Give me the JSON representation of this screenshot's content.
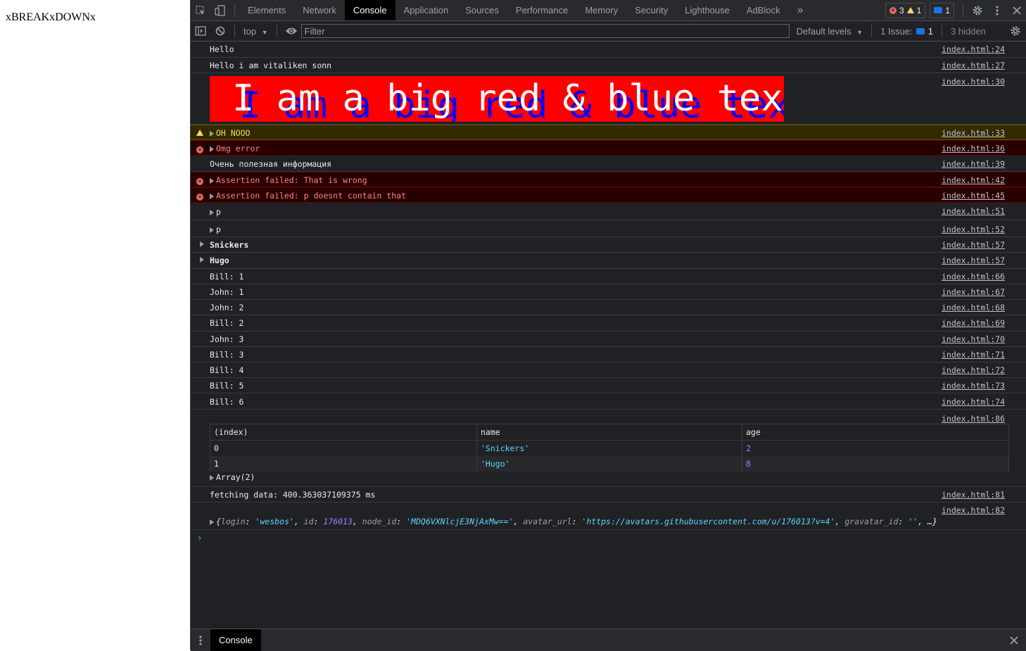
{
  "page": {
    "text": "xBREAKxDOWNx"
  },
  "devtools": {
    "tabs": [
      "Elements",
      "Network",
      "Console",
      "Application",
      "Sources",
      "Performance",
      "Memory",
      "Security",
      "Lighthouse",
      "AdBlock"
    ],
    "active_tab": "Console",
    "more_tabs": "»",
    "counters": {
      "errors": "3",
      "warnings": "1",
      "messages": "1"
    },
    "toolbar": {
      "context": "top",
      "filter_placeholder": "Filter",
      "levels": "Default levels",
      "issues_label": "1 Issue:",
      "issues_count": "1",
      "hidden": "3 hidden"
    },
    "messages": [
      {
        "text": "Hello",
        "source": "index.html:24"
      },
      {
        "text": "Hello i am vitaliken sonn",
        "source": "index.html:27"
      },
      {
        "text": "I am a big red & blue text",
        "source": "index.html:30"
      },
      {
        "text": "OH NOOO",
        "source": "index.html:33"
      },
      {
        "text": "Omg error",
        "source": "index.html:36"
      },
      {
        "text": "Очень полезная информация",
        "source": "index.html:39"
      },
      {
        "text": "Assertion failed: That is wrong",
        "source": "index.html:42"
      },
      {
        "text": "Assertion failed: p doesnt contain that",
        "source": "index.html:45"
      },
      {
        "text": "p",
        "source": "index.html:51"
      },
      {
        "text": "p",
        "source": "index.html:52"
      },
      {
        "text": "Snickers",
        "source": "index.html:57"
      },
      {
        "text": "Hugo",
        "source": "index.html:57"
      },
      {
        "text": "Bill: 1",
        "source": "index.html:66"
      },
      {
        "text": "John: 1",
        "source": "index.html:67"
      },
      {
        "text": "John: 2",
        "source": "index.html:68"
      },
      {
        "text": "Bill: 2",
        "source": "index.html:69"
      },
      {
        "text": "John: 3",
        "source": "index.html:70"
      },
      {
        "text": "Bill: 3",
        "source": "index.html:71"
      },
      {
        "text": "Bill: 4",
        "source": "index.html:72"
      },
      {
        "text": "Bill: 5",
        "source": "index.html:73"
      },
      {
        "text": "Bill: 6",
        "source": "index.html:74"
      },
      {
        "source": "index.html:86"
      },
      {
        "text": "fetching data: 400.363037109375 ms",
        "source": "index.html:81"
      },
      {
        "source": "index.html:82"
      }
    ],
    "table": {
      "headers": [
        "(index)",
        "name",
        "age"
      ],
      "rows": [
        {
          "index": "0",
          "name": "'Snickers'",
          "age": "2"
        },
        {
          "index": "1",
          "name": "'Hugo'",
          "age": "8"
        }
      ],
      "array_label": "Array(2)"
    },
    "object_preview": {
      "open": "{",
      "k1": "login",
      "v1": "'wesbos'",
      "k2": "id",
      "v2": "176013",
      "k3": "node_id",
      "v3": "'MDQ6VXNlcjE3NjAxMw=='",
      "k4": "avatar_url",
      "v4": "'https://avatars.githubusercontent.com/u/176013?v=4'",
      "k5": "gravatar_id",
      "v5": "''",
      "close": ", …}"
    },
    "prompt": "›",
    "drawer_tab": "Console"
  }
}
